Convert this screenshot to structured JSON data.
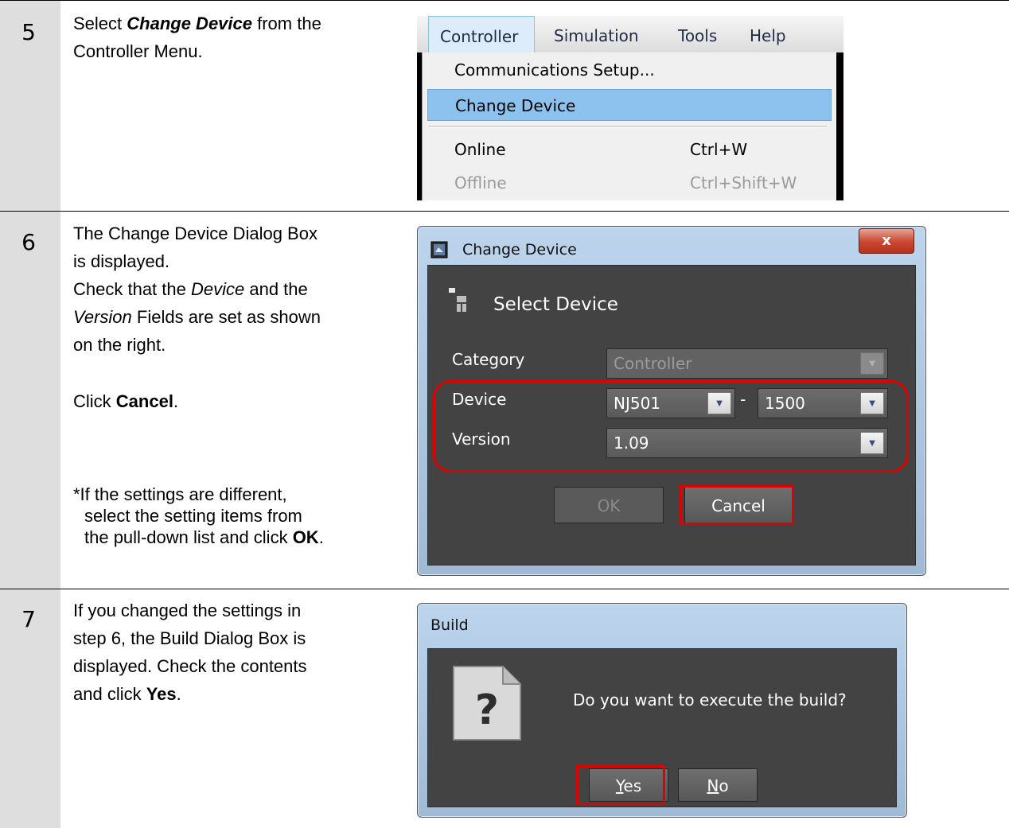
{
  "steps": [
    {
      "number": "5",
      "instruction": {
        "pre": "Select ",
        "bold": "Change Device",
        "post": " from the",
        "line2": "Controller Menu."
      },
      "menu_screenshot": {
        "menubar": [
          "Controller",
          "Simulation",
          "Tools",
          "Help"
        ],
        "active_menu": "Controller",
        "items": [
          {
            "label": "Communications Setup...",
            "shortcut": "",
            "state": "normal"
          },
          {
            "label": "Change Device",
            "shortcut": "",
            "state": "highlighted"
          },
          {
            "label": "Online",
            "shortcut": "Ctrl+W",
            "state": "normal"
          },
          {
            "label": "Offline",
            "shortcut": "Ctrl+Shift+W",
            "state": "disabled"
          }
        ]
      }
    },
    {
      "number": "6",
      "instruction": {
        "l1": "The Change Device Dialog Box",
        "l2": "is displayed.",
        "l3a": "Check that the ",
        "l3i": "Device",
        "l3b": " and the",
        "l4i": "Version",
        "l4b": " Fields are set as shown",
        "l5": "on the right.",
        "l6a": "Click ",
        "l6b": "Cancel",
        "l6c": ".",
        "note1": "*If the settings are different,",
        "note2": "select the setting items from",
        "note3a": "the pull-down list and click ",
        "note3b": "OK",
        "note3c": "."
      },
      "dialog": {
        "title": "Change Device",
        "close": "x",
        "heading": "Select Device",
        "category_label": "Category",
        "category_value": "Controller",
        "device_label": "Device",
        "device_value": "NJ501",
        "device_dash": "-",
        "device_sub_value": "1500",
        "version_label": "Version",
        "version_value": "1.09",
        "ok_label": "OK",
        "cancel_label": "Cancel"
      }
    },
    {
      "number": "7",
      "instruction": {
        "l1": "If you changed the settings in",
        "l2": "step 6, the Build Dialog Box is",
        "l3": "displayed. Check the contents",
        "l4a": "and click ",
        "l4b": "Yes",
        "l4c": "."
      },
      "dialog": {
        "title": "Build",
        "message": "Do you want to execute the build?",
        "yes_mnemonic": "Y",
        "yes_rest": "es",
        "no_mnemonic": "N",
        "no_rest": "o"
      }
    }
  ],
  "colors": {
    "highlight_red": "#e00000",
    "menu_highlight": "#8dc2ef",
    "number_column": "#dedede"
  }
}
